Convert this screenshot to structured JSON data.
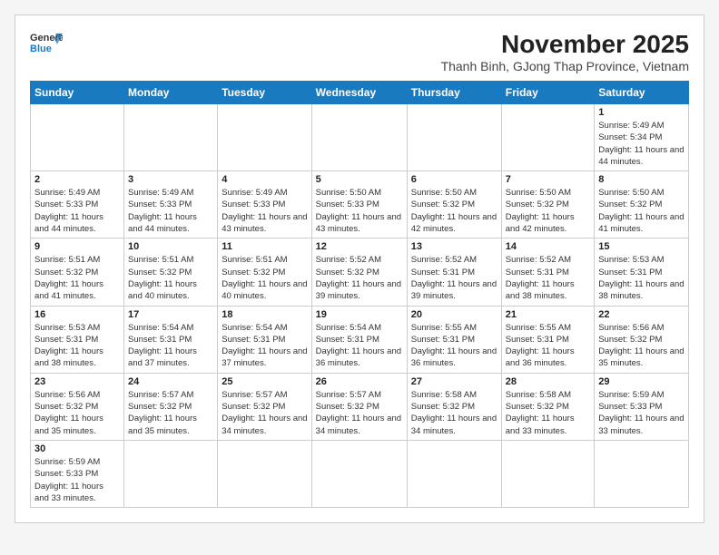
{
  "header": {
    "logo_general": "General",
    "logo_blue": "Blue",
    "month_title": "November 2025",
    "subtitle": "Thanh Binh, GJong Thap Province, Vietnam"
  },
  "days_of_week": [
    "Sunday",
    "Monday",
    "Tuesday",
    "Wednesday",
    "Thursday",
    "Friday",
    "Saturday"
  ],
  "weeks": [
    [
      {
        "day": "",
        "content": ""
      },
      {
        "day": "",
        "content": ""
      },
      {
        "day": "",
        "content": ""
      },
      {
        "day": "",
        "content": ""
      },
      {
        "day": "",
        "content": ""
      },
      {
        "day": "",
        "content": ""
      },
      {
        "day": "1",
        "content": "Sunrise: 5:49 AM\nSunset: 5:34 PM\nDaylight: 11 hours and 44 minutes."
      }
    ],
    [
      {
        "day": "2",
        "content": "Sunrise: 5:49 AM\nSunset: 5:33 PM\nDaylight: 11 hours and 44 minutes."
      },
      {
        "day": "3",
        "content": "Sunrise: 5:49 AM\nSunset: 5:33 PM\nDaylight: 11 hours and 44 minutes."
      },
      {
        "day": "4",
        "content": "Sunrise: 5:49 AM\nSunset: 5:33 PM\nDaylight: 11 hours and 43 minutes."
      },
      {
        "day": "5",
        "content": "Sunrise: 5:50 AM\nSunset: 5:33 PM\nDaylight: 11 hours and 43 minutes."
      },
      {
        "day": "6",
        "content": "Sunrise: 5:50 AM\nSunset: 5:32 PM\nDaylight: 11 hours and 42 minutes."
      },
      {
        "day": "7",
        "content": "Sunrise: 5:50 AM\nSunset: 5:32 PM\nDaylight: 11 hours and 42 minutes."
      },
      {
        "day": "8",
        "content": "Sunrise: 5:50 AM\nSunset: 5:32 PM\nDaylight: 11 hours and 41 minutes."
      }
    ],
    [
      {
        "day": "9",
        "content": "Sunrise: 5:51 AM\nSunset: 5:32 PM\nDaylight: 11 hours and 41 minutes."
      },
      {
        "day": "10",
        "content": "Sunrise: 5:51 AM\nSunset: 5:32 PM\nDaylight: 11 hours and 40 minutes."
      },
      {
        "day": "11",
        "content": "Sunrise: 5:51 AM\nSunset: 5:32 PM\nDaylight: 11 hours and 40 minutes."
      },
      {
        "day": "12",
        "content": "Sunrise: 5:52 AM\nSunset: 5:32 PM\nDaylight: 11 hours and 39 minutes."
      },
      {
        "day": "13",
        "content": "Sunrise: 5:52 AM\nSunset: 5:31 PM\nDaylight: 11 hours and 39 minutes."
      },
      {
        "day": "14",
        "content": "Sunrise: 5:52 AM\nSunset: 5:31 PM\nDaylight: 11 hours and 38 minutes."
      },
      {
        "day": "15",
        "content": "Sunrise: 5:53 AM\nSunset: 5:31 PM\nDaylight: 11 hours and 38 minutes."
      }
    ],
    [
      {
        "day": "16",
        "content": "Sunrise: 5:53 AM\nSunset: 5:31 PM\nDaylight: 11 hours and 38 minutes."
      },
      {
        "day": "17",
        "content": "Sunrise: 5:54 AM\nSunset: 5:31 PM\nDaylight: 11 hours and 37 minutes."
      },
      {
        "day": "18",
        "content": "Sunrise: 5:54 AM\nSunset: 5:31 PM\nDaylight: 11 hours and 37 minutes."
      },
      {
        "day": "19",
        "content": "Sunrise: 5:54 AM\nSunset: 5:31 PM\nDaylight: 11 hours and 36 minutes."
      },
      {
        "day": "20",
        "content": "Sunrise: 5:55 AM\nSunset: 5:31 PM\nDaylight: 11 hours and 36 minutes."
      },
      {
        "day": "21",
        "content": "Sunrise: 5:55 AM\nSunset: 5:31 PM\nDaylight: 11 hours and 36 minutes."
      },
      {
        "day": "22",
        "content": "Sunrise: 5:56 AM\nSunset: 5:32 PM\nDaylight: 11 hours and 35 minutes."
      }
    ],
    [
      {
        "day": "23",
        "content": "Sunrise: 5:56 AM\nSunset: 5:32 PM\nDaylight: 11 hours and 35 minutes."
      },
      {
        "day": "24",
        "content": "Sunrise: 5:57 AM\nSunset: 5:32 PM\nDaylight: 11 hours and 35 minutes."
      },
      {
        "day": "25",
        "content": "Sunrise: 5:57 AM\nSunset: 5:32 PM\nDaylight: 11 hours and 34 minutes."
      },
      {
        "day": "26",
        "content": "Sunrise: 5:57 AM\nSunset: 5:32 PM\nDaylight: 11 hours and 34 minutes."
      },
      {
        "day": "27",
        "content": "Sunrise: 5:58 AM\nSunset: 5:32 PM\nDaylight: 11 hours and 34 minutes."
      },
      {
        "day": "28",
        "content": "Sunrise: 5:58 AM\nSunset: 5:32 PM\nDaylight: 11 hours and 33 minutes."
      },
      {
        "day": "29",
        "content": "Sunrise: 5:59 AM\nSunset: 5:33 PM\nDaylight: 11 hours and 33 minutes."
      }
    ],
    [
      {
        "day": "30",
        "content": "Sunrise: 5:59 AM\nSunset: 5:33 PM\nDaylight: 11 hours and 33 minutes."
      },
      {
        "day": "",
        "content": ""
      },
      {
        "day": "",
        "content": ""
      },
      {
        "day": "",
        "content": ""
      },
      {
        "day": "",
        "content": ""
      },
      {
        "day": "",
        "content": ""
      },
      {
        "day": "",
        "content": ""
      }
    ]
  ]
}
